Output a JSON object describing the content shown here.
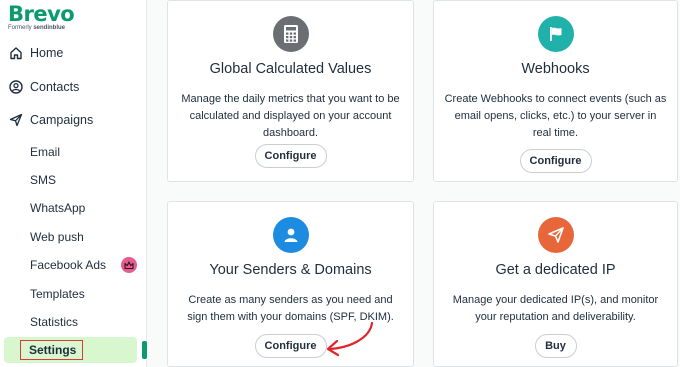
{
  "brand": {
    "name": "Brevo",
    "formerly": "Formerly",
    "formerly_name": "sendinblue"
  },
  "sidebar": {
    "main": [
      {
        "label": "Home",
        "icon": "home-icon"
      },
      {
        "label": "Contacts",
        "icon": "contacts-icon"
      },
      {
        "label": "Campaigns",
        "icon": "send-icon"
      }
    ],
    "sub": [
      {
        "label": "Email"
      },
      {
        "label": "SMS"
      },
      {
        "label": "WhatsApp"
      },
      {
        "label": "Web push"
      },
      {
        "label": "Facebook Ads",
        "badge": "crown-icon"
      },
      {
        "label": "Templates"
      },
      {
        "label": "Statistics"
      },
      {
        "label": "Settings",
        "active": true
      }
    ]
  },
  "cards": [
    {
      "title": "Global Calculated Values",
      "desc": "Manage the daily metrics that you want to be calculated and displayed on your account dashboard.",
      "button": "Configure",
      "icon": "calculator-icon",
      "color": "#6b6f73"
    },
    {
      "title": "Webhooks",
      "desc": "Create Webhooks to connect events (such as email opens, clicks, etc.) to your server in real time.",
      "button": "Configure",
      "icon": "flag-icon",
      "color": "#20b2aa"
    },
    {
      "title": "Your Senders & Domains",
      "desc": "Create as many senders as you need and sign them with your domains (SPF, DKIM).",
      "button": "Configure",
      "icon": "user-icon",
      "color": "#1d8be0"
    },
    {
      "title": "Get a dedicated IP",
      "desc": "Manage your dedicated IP(s), and monitor your reputation and deliverability.",
      "button": "Buy",
      "icon": "paper-plane-icon",
      "color": "#e8673a"
    }
  ],
  "colors": {
    "brand": "#0b996e",
    "active_bg": "#d9f7cf",
    "highlight": "#d93a3a",
    "arrow": "#e0262c"
  }
}
